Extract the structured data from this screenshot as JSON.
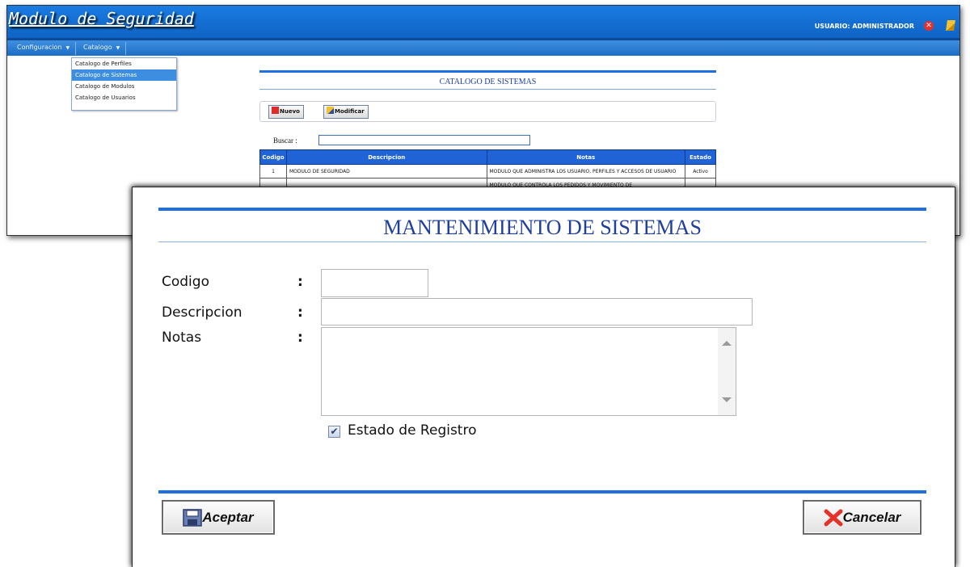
{
  "app": {
    "title": "Modulo de Seguridad",
    "user_label": "USUARIO: ADMINISTRADOR",
    "close_glyph": "✕"
  },
  "menu": {
    "items": [
      {
        "label": "Configuracion",
        "caret": "▼"
      },
      {
        "label": "Catalogo",
        "caret": "▼"
      }
    ]
  },
  "catalog_dropdown": {
    "items": [
      {
        "label": "Catalogo de Perfiles",
        "selected": false
      },
      {
        "label": "Catalogo de Sistemas",
        "selected": true
      },
      {
        "label": "Catalogo de Modulos",
        "selected": false
      },
      {
        "label": "Catalogo de Usuarios",
        "selected": false
      }
    ]
  },
  "catalog": {
    "title": "CATALOGO DE SISTEMAS",
    "nuevo_label": "Nuevo",
    "modificar_label": "Modificar",
    "buscar_label": "Buscar  :",
    "buscar_value": "",
    "columns": [
      "Codigo",
      "Descripcion",
      "Notas",
      "Estado"
    ],
    "rows": [
      {
        "codigo": "1",
        "descripcion": "MODULO DE SEGURIDAD",
        "notas": "MODULO QUE ADMINISTRA LOS USUARIO, PERFILES Y ACCESOS DE USUARIO",
        "estado": "Activo"
      },
      {
        "codigo": "",
        "descripcion": "",
        "notas": "MODULO QUE CONTROLA LOS PEDIDOS Y MOVIMIENTO DE",
        "estado": ""
      }
    ]
  },
  "dialog": {
    "title": "MANTENIMIENTO DE SISTEMAS",
    "fields": {
      "codigo_label": "Codigo",
      "descripcion_label": "Descripcion",
      "notas_label": "Notas",
      "colon": ":",
      "codigo_value": "",
      "descripcion_value": "",
      "notas_value": ""
    },
    "estado_label": "Estado de Registro",
    "estado_checked": true,
    "check_glyph": "✔",
    "aceptar_label": "Aceptar",
    "cancelar_label": "Cancelar"
  },
  "colors": {
    "header_blue": "#1a7be2",
    "rule_blue": "#1f6fe0",
    "title_blue": "#1f3f9e",
    "cancel_red": "#e4322b"
  }
}
